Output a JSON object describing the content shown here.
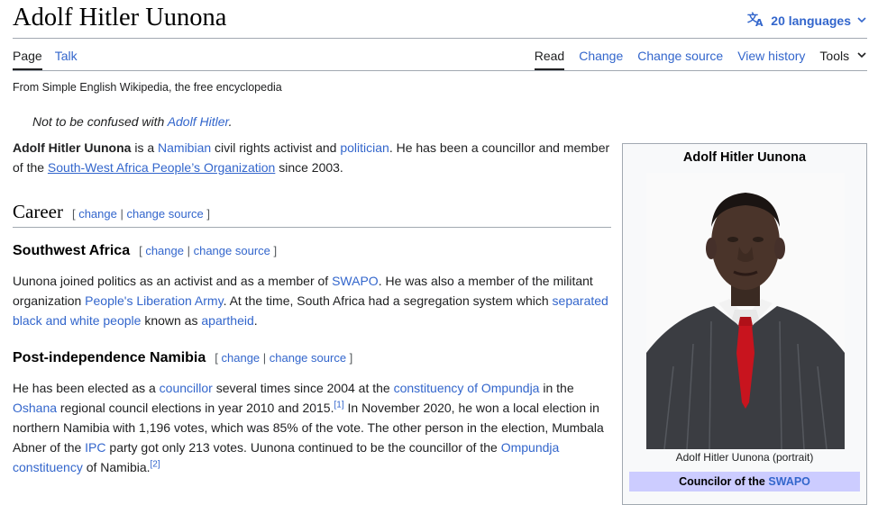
{
  "header": {
    "title": "Adolf Hitler Uunona",
    "languages_label": "20 languages"
  },
  "tabs": {
    "page": "Page",
    "talk": "Talk",
    "read": "Read",
    "change": "Change",
    "change_source": "Change source",
    "view_history": "View history",
    "tools": "Tools"
  },
  "tagline": "From Simple English Wikipedia, the free encyclopedia",
  "hatnote": {
    "prefix": "Not to be confused with ",
    "link": "Adolf Hitler",
    "suffix": "."
  },
  "lead": {
    "bold_name": "Adolf Hitler Uunona",
    "t1": " is a ",
    "l1": "Namibian",
    "t2": " civil rights activist and ",
    "l2": "politician",
    "t3": ". He has been a councillor and member of the ",
    "l3": "South-West Africa People’s Organization",
    "t4": " since 2003."
  },
  "edit_links": {
    "open": "[ ",
    "change": "change",
    "sep": " | ",
    "change_source": "change source",
    "close": " ]"
  },
  "sections": {
    "career": "Career",
    "southwest": "Southwest Africa",
    "post": "Post-independence Namibia"
  },
  "para1": {
    "t1": "Uunona joined politics as an activist and as a member of ",
    "l1": "SWAPO",
    "t2": ". He was also a member of the militant organization ",
    "l2": "People's Liberation Army",
    "t3": ". At the time, South Africa had a segregation system which ",
    "l3": "separated black and white people",
    "t4": " known as ",
    "l4": "apartheid",
    "t5": "."
  },
  "para2": {
    "t1": "He has been elected as a ",
    "l1": "councillor",
    "t2": " several times since 2004 at the ",
    "l2": "constituency of Ompundja",
    "t3": " in the ",
    "l3": "Oshana",
    "t4": " regional council elections in year 2010 and 2015.",
    "ref1": "[1]",
    "t5": " In November 2020, he won a local election in northern Namibia with 1,196 votes, which was 85% of the vote. The other person in the election, Mumbala Abner of the ",
    "l4": "IPC",
    "t6": " party got only 213 votes. Uunona continued to be the councillor of the ",
    "l5": "Ompundja constituency",
    "t7": " of Namibia.",
    "ref2": "[2]"
  },
  "infobox": {
    "title": "Adolf Hitler Uunona",
    "caption": "Adolf Hitler Uunona (portrait)",
    "band_prefix": "Councilor of the ",
    "band_link": "SWAPO",
    "band_color": "#ccccff"
  },
  "colors": {
    "link": "#3366cc",
    "text": "#202122",
    "border": "#a2a9b1"
  }
}
